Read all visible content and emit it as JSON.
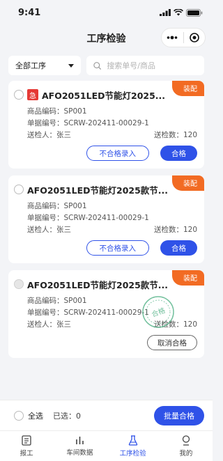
{
  "status_bar": {
    "time": "9:41"
  },
  "nav": {
    "title": "工序检验"
  },
  "filter": {
    "process_select": "全部工序",
    "search_placeholder": "搜索单号/商品"
  },
  "cards": [
    {
      "tag": "装配",
      "urgent_label": "急",
      "title": "AFO2051LED节能灯2025...",
      "product_code": "商品编码：SP001",
      "doc_no": "单据编号：SCRW-202411-00029-1",
      "inspector": "送检人：张三",
      "qty": "送检数：120",
      "btn_unqualified": "不合格录入",
      "btn_qualified": "合格"
    },
    {
      "tag": "装配",
      "title": "AFO2051LED节能灯2025款节...",
      "product_code": "商品编码：SP001",
      "doc_no": "单据编号：SCRW-202411-00029-1",
      "inspector": "送检人：张三",
      "qty": "送检数：120",
      "btn_unqualified": "不合格录入",
      "btn_qualified": "合格"
    },
    {
      "tag": "装配",
      "title": "AFO2051LED节能灯2025款节...",
      "product_code": "商品编码：SP001",
      "doc_no": "单据编号：SCRW-202411-00029-1",
      "inspector": "送检人：张三",
      "qty": "送检数：120",
      "stamp_text": "合格",
      "btn_cancel": "取消合格"
    }
  ],
  "bottom": {
    "select_all": "全选",
    "selected": "已选：0",
    "batch_button": "批量合格"
  },
  "tabs": [
    {
      "label": "报工",
      "icon": "report-icon"
    },
    {
      "label": "车间数据",
      "icon": "bar-chart-icon"
    },
    {
      "label": "工序检验",
      "icon": "flask-icon",
      "active": true
    },
    {
      "label": "我的",
      "icon": "user-icon"
    }
  ],
  "colors": {
    "primary": "#2f52e8",
    "tag": "#f26b23",
    "urgent": "#e53935",
    "stamp": "#3aa776"
  }
}
